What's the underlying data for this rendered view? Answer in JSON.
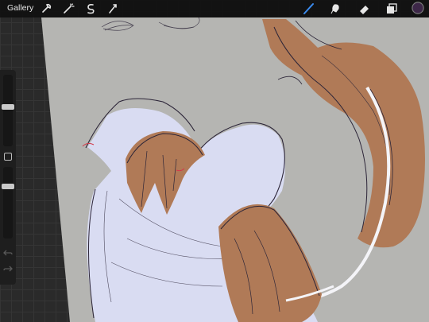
{
  "toolbar": {
    "gallery_label": "Gallery",
    "left_tools": [
      {
        "name": "actions-icon"
      },
      {
        "name": "adjustments-icon"
      },
      {
        "name": "selection-icon"
      },
      {
        "name": "transform-icon"
      }
    ],
    "right_tools": [
      {
        "name": "brush-icon",
        "active": true
      },
      {
        "name": "smudge-icon"
      },
      {
        "name": "eraser-icon"
      },
      {
        "name": "layers-icon"
      },
      {
        "name": "color-swatch"
      }
    ],
    "active_color": "#3d2748",
    "accent_color": "#3b8cf0"
  },
  "sidebar": {
    "brush_size_level": 0.55,
    "opacity_level": 0.75
  },
  "canvas": {
    "background_color": "#b5b5b2",
    "palette": {
      "fur_brown": "#b07a57",
      "body_fill": "#d9dcf2",
      "sketch_line": "#2c2538",
      "red_line": "#d23a4a",
      "white_line": "#f4f4f8"
    }
  }
}
